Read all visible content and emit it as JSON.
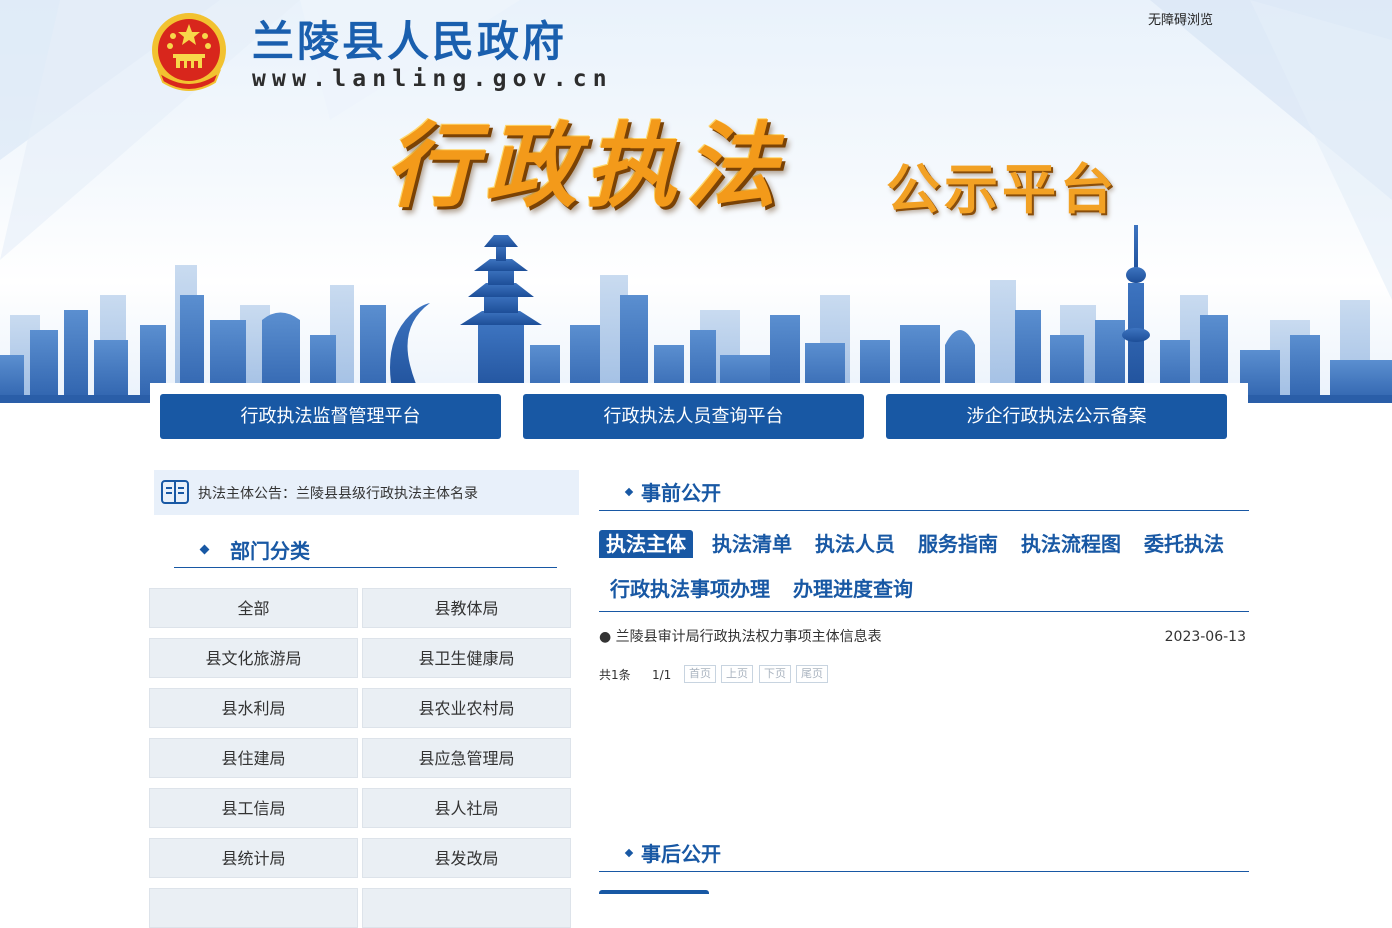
{
  "header": {
    "site_name": "兰陵县人民政府",
    "site_url": "www.lanling.gov.cn",
    "accessible_link": "无障碍浏览",
    "banner_title": "行政执法",
    "banner_subtitle": "公示平台"
  },
  "nav_buttons": [
    "行政执法监督管理平台",
    "行政执法人员查询平台",
    "涉企行政执法公示备案"
  ],
  "notice": {
    "icon": "book-icon",
    "text": "执法主体公告：兰陵县县级行政执法主体名录"
  },
  "departments": {
    "heading": "部门分类",
    "items": [
      "全部",
      "县教体局",
      "县文化旅游局",
      "县卫生健康局",
      "县水利局",
      "县农业农村局",
      "县住建局",
      "县应急管理局",
      "县工信局",
      "县人社局",
      "县统计局",
      "县发改局"
    ]
  },
  "pre_disclosure": {
    "heading": "事前公开",
    "tabs": [
      "执法主体",
      "执法清单",
      "执法人员",
      "服务指南",
      "执法流程图",
      "委托执法",
      "行政执法事项办理",
      "办理进度查询"
    ],
    "active_tab": "执法主体",
    "items": [
      {
        "title": "兰陵县审计局行政执法权力事项主体信息表",
        "date": "2023-06-13"
      }
    ],
    "pager": {
      "total": "共1条",
      "page": "1/1",
      "first": "首页",
      "prev": "上页",
      "next": "下页",
      "last": "尾页"
    }
  },
  "post_disclosure": {
    "heading": "事后公开"
  },
  "colors": {
    "primary": "#1858a4",
    "banner_title": "#f39a1a",
    "cell_bg": "#eaeff4",
    "notice_bg": "#e8f0fa"
  }
}
